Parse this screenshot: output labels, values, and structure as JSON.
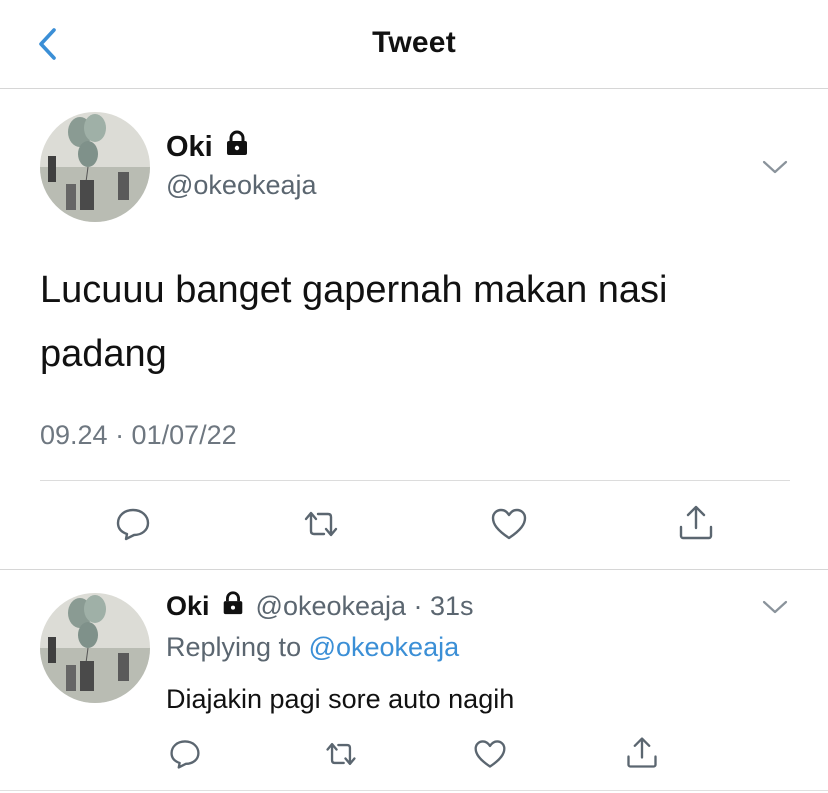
{
  "header": {
    "title": "Tweet",
    "back_icon": "chevron-left-icon",
    "accent": "#3b8fd6"
  },
  "main_tweet": {
    "name": "Oki",
    "protected_icon": "lock-icon",
    "handle": "@okeokeaja",
    "text": "Lucuuu banget gapernah makan nasi padang",
    "timestamp": "09.24 · 01/07/22",
    "actions": [
      "reply-icon",
      "retweet-icon",
      "like-icon",
      "share-icon"
    ]
  },
  "reply": {
    "name": "Oki",
    "meta": "@okeokeaja · 31s",
    "replying_prefix": "Replying to ",
    "replying_handle": "@okeokeaja",
    "text": "Diajakin pagi sore auto nagih",
    "actions": [
      "reply-icon",
      "retweet-icon",
      "like-icon",
      "share-icon"
    ]
  },
  "colors": {
    "text": "#111111",
    "secondary": "#5b6670",
    "link": "#3b8fd6",
    "icon": "#5b6670"
  }
}
